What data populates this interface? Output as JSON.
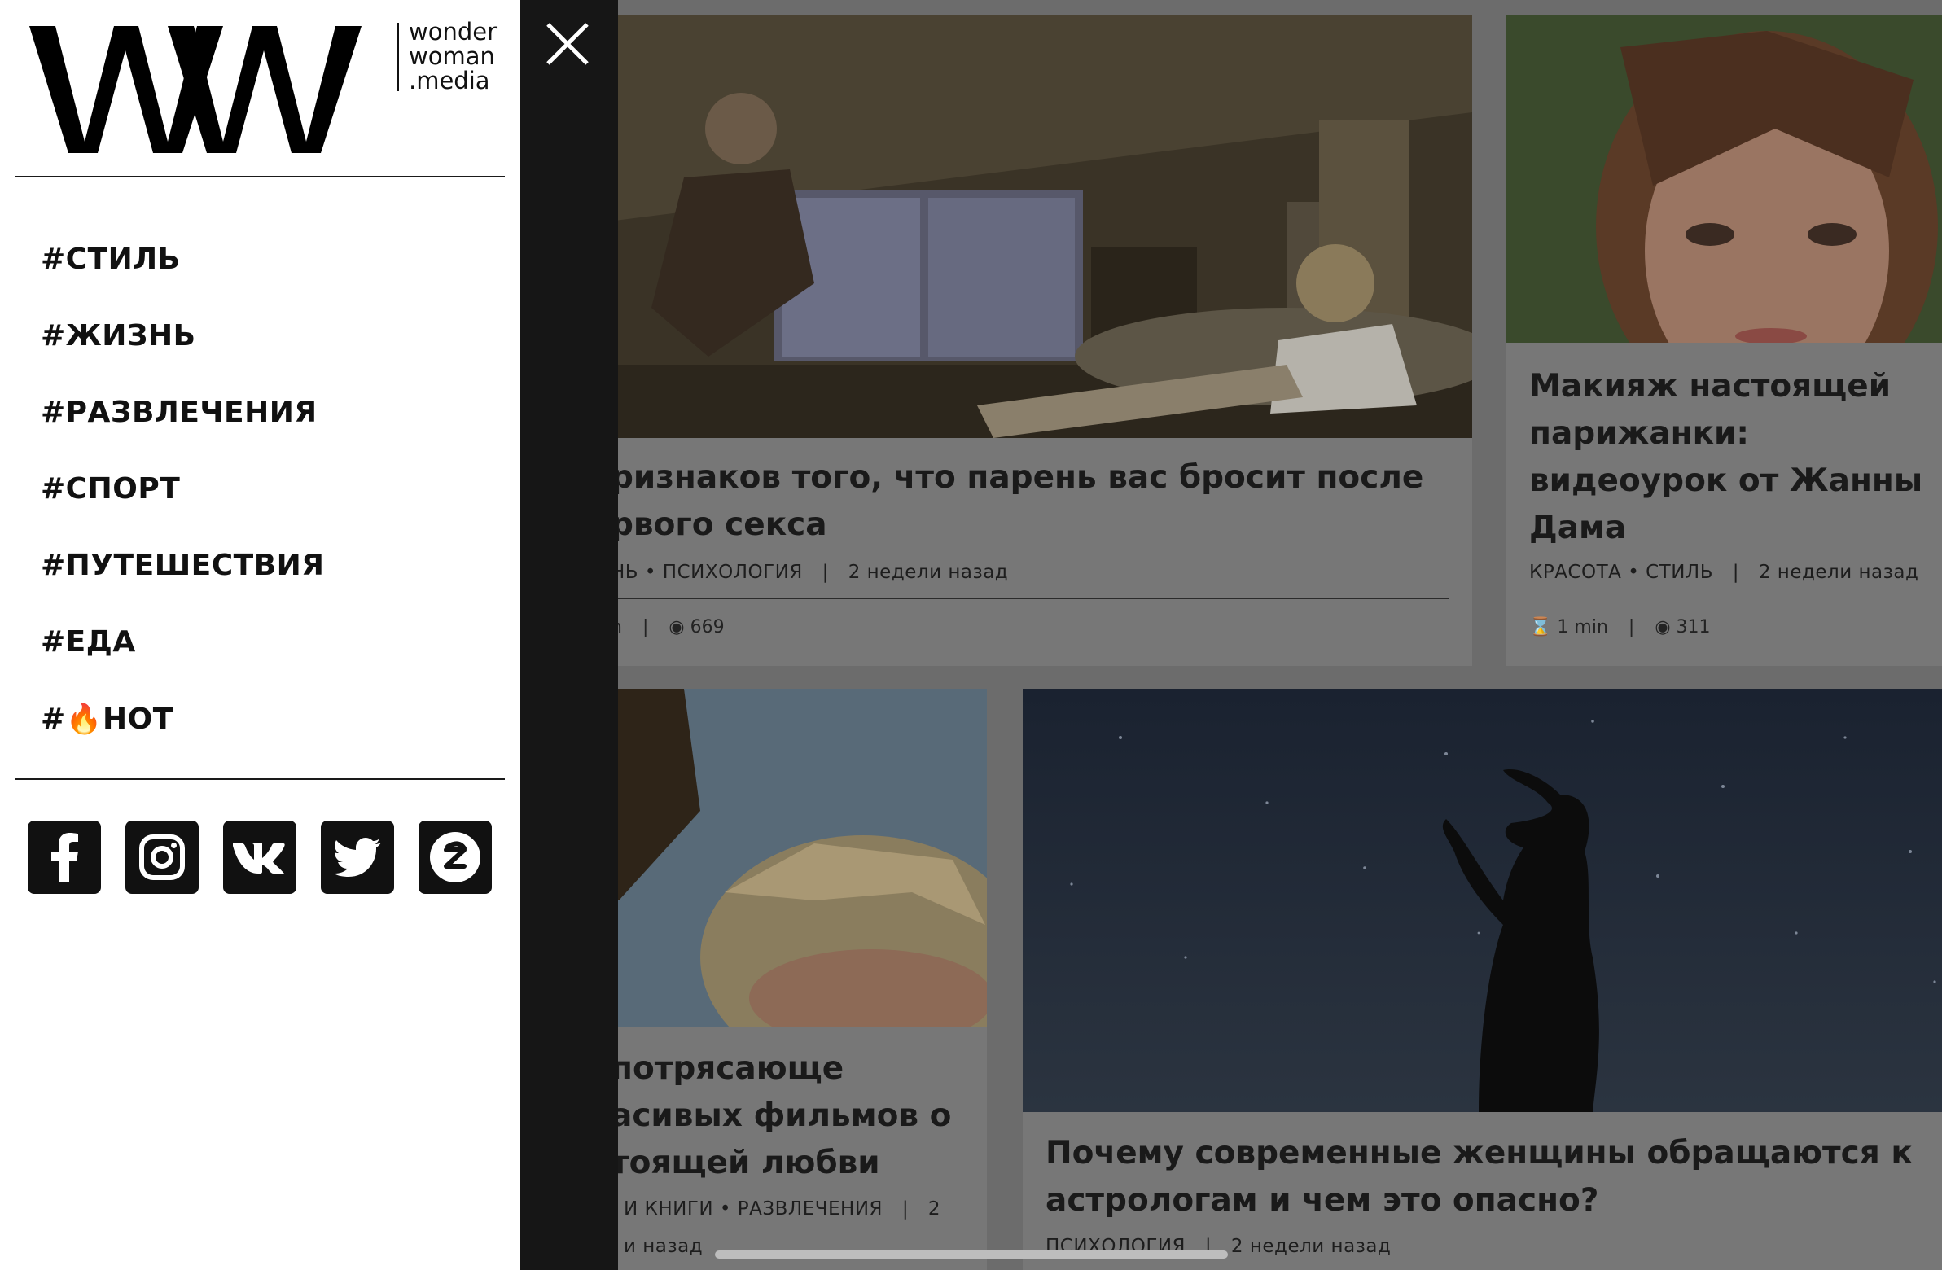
{
  "logo": {
    "letters": "WW",
    "sub_lines": [
      "wonder",
      "woman",
      ".media"
    ]
  },
  "menu": {
    "items": [
      "#СТИЛЬ",
      "#ЖИЗНЬ",
      "#РАЗВЛЕЧЕНИЯ",
      "#СПОРТ",
      "#ПУТЕШЕСТВИЯ",
      "#ЕДА",
      "#🔥HOT"
    ]
  },
  "social": [
    "facebook-icon",
    "instagram-icon",
    "vk-icon",
    "twitter-icon",
    "zen-icon"
  ],
  "close_icon": "close-icon",
  "feed": {
    "card1": {
      "title_line1": "ризнаков того, что парень вас бросит после",
      "title_line2": "рвого секса",
      "meta_cat1": "НЬ",
      "meta_cat2": "ПСИХОЛОГИЯ",
      "meta_time": "2 недели назад",
      "stats_read": "n",
      "stats_views": "669"
    },
    "card2": {
      "title_line1": "Макияж настоящей",
      "title_line2": "парижанки:",
      "title_line3": "видеоурок от Жанны",
      "title_line4": "Дама",
      "meta_cat1": "КРАСОТА",
      "meta_cat2": "СТИЛЬ",
      "meta_time": "2 недели назад",
      "stats_read": "1 min",
      "stats_views": "311"
    },
    "card3": {
      "title_line1": "потрясающе",
      "title_line2": "асивых фильмов о",
      "title_line3": "тоящей любви",
      "meta_cat1": "И КНИГИ",
      "meta_cat2": "РАЗВЛЕЧЕНИЯ",
      "meta_time": "2",
      "meta_time2": "и назад"
    },
    "card4": {
      "title_line1": "Почему современные женщины обращаются к",
      "title_line2": "астрологам и чем это опасно?",
      "meta_cat1": "ПСИХОЛОГИЯ",
      "meta_time": "2 недели назад"
    }
  }
}
